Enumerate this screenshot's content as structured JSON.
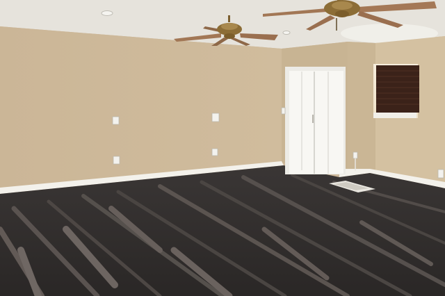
{
  "scene": {
    "colors": {
      "ceiling": "#e8e4dc",
      "wall_left": "#cdb99b",
      "wall_back": "#c9b594",
      "wall_right": "#d2bf9f",
      "baseboard": "#f4f2ec",
      "floor_dark": "#2f2c2b",
      "floor_mid": "#4a4543",
      "floor_light": "#6b6461",
      "closet_door": "#f7f6f2",
      "blinds": "#3a2118",
      "fan_brass": "#8a6a34",
      "fan_blade": "#9c7150"
    },
    "icons": {
      "fan": "ceiling-fan-icon",
      "light": "recessed-light-icon",
      "switch": "light-switch-icon",
      "outlet": "wall-outlet-icon",
      "vent": "floor-vent-icon"
    }
  }
}
